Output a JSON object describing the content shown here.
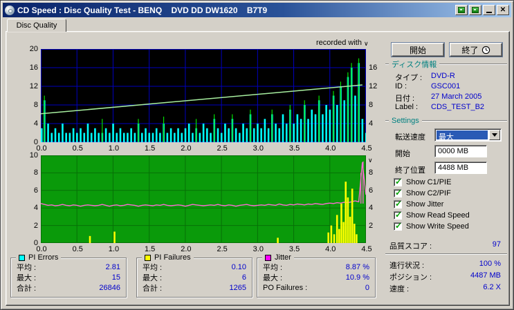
{
  "window": {
    "title": "CD Speed : Disc Quality Test - BENQ    DVD DD DW1620    B7T9"
  },
  "tab_label": "Disc Quality",
  "recorded_with": "recorded with",
  "icons": {
    "close": "✕",
    "check": "✓",
    "axis_arrow": "∨"
  },
  "colors": {
    "plot1_bg": "#000000",
    "plot1_grid": "#0000c0",
    "plot2_bg": "#0a9a0a",
    "plot2_grid": "#077007",
    "pi_errors": "#00ffff",
    "pie_spikes": "#00e000",
    "write_speed": "#a8f0a0",
    "jitter": "#ff6ad5",
    "pi_failures": "#ffff00",
    "value_text": "#0000cc",
    "group_title": "#008080"
  },
  "chart_data": [
    {
      "type": "bar",
      "title": "PI Errors vs disc position (GB)",
      "x_start": 0,
      "x_step": 0.05,
      "xlim": [
        0,
        4.5
      ],
      "ylim": [
        0,
        20
      ],
      "x_tick_labels": [
        "0.0",
        "0.5",
        "1.0",
        "1.5",
        "2.0",
        "2.5",
        "3.0",
        "3.5",
        "4.0",
        "4.5"
      ],
      "y_ticks_left": [
        20,
        16,
        12,
        8,
        4,
        0
      ],
      "y_ticks_right": [
        16,
        12,
        8,
        4
      ],
      "grid": true,
      "series": [
        {
          "name": "PI Errors",
          "color": "#00ffff",
          "values": [
            3,
            9,
            4,
            2,
            3,
            2,
            4,
            2,
            2,
            3,
            2,
            3,
            2,
            4,
            2,
            3,
            2,
            2,
            3,
            2,
            4,
            2,
            3,
            2,
            2,
            3,
            2,
            4,
            2,
            3,
            2,
            2,
            3,
            2,
            4,
            2,
            3,
            2,
            3,
            2,
            3,
            4,
            2,
            3,
            2,
            4,
            3,
            2,
            5,
            3,
            2,
            4,
            3,
            5,
            3,
            2,
            4,
            3,
            6,
            3,
            4,
            3,
            5,
            3,
            6,
            4,
            3,
            6,
            4,
            7,
            4,
            6,
            5,
            8,
            5,
            7,
            6,
            9,
            6,
            8,
            7,
            10,
            8,
            12,
            9,
            14,
            16,
            10,
            17,
            5,
            2
          ]
        },
        {
          "name": "PIE spikes",
          "color": "#00e000",
          "points": [
            [
              0.05,
              10
            ],
            [
              0.85,
              5
            ],
            [
              1.35,
              5
            ],
            [
              1.7,
              5.5
            ],
            [
              2.15,
              5
            ],
            [
              2.4,
              6
            ],
            [
              2.65,
              6
            ],
            [
              2.9,
              7
            ],
            [
              3.2,
              7
            ],
            [
              3.45,
              8
            ],
            [
              3.65,
              9
            ],
            [
              3.85,
              10
            ],
            [
              4.05,
              11
            ],
            [
              4.15,
              13
            ],
            [
              4.25,
              15
            ],
            [
              4.3,
              17
            ],
            [
              4.4,
              18
            ]
          ]
        },
        {
          "name": "Write Speed",
          "color": "#a8f0a0",
          "points": [
            [
              0,
              6.1
            ],
            [
              4.45,
              12.3
            ]
          ]
        }
      ]
    },
    {
      "type": "line",
      "title": "Jitter and PI Failures vs disc position (GB)",
      "x_start": 0,
      "x_step": 0.05,
      "xlim": [
        0,
        4.5
      ],
      "ylim": [
        0,
        10
      ],
      "x_tick_labels": [
        "0.0",
        "0.5",
        "1.0",
        "1.5",
        "2.0",
        "2.5",
        "3.0",
        "3.5",
        "4.0",
        "4.5"
      ],
      "y_ticks_left": [
        10,
        8,
        6,
        4,
        2,
        0
      ],
      "y_ticks_right": [
        8,
        6,
        4,
        2
      ],
      "grid": true,
      "series": [
        {
          "name": "Jitter",
          "color": "#ff6ad5",
          "values": [
            4.5,
            4.4,
            4.3,
            4.35,
            4.25,
            4.3,
            4.4,
            4.3,
            4.25,
            4.35,
            4.3,
            4.2,
            4.3,
            4.35,
            4.3,
            4.25,
            4.3,
            4.4,
            4.3,
            4.2,
            4.3,
            4.35,
            4.25,
            4.3,
            4.4,
            4.35,
            4.3,
            4.2,
            4.3,
            4.35,
            4.3,
            4.25,
            4.35,
            4.3,
            4.4,
            4.3,
            4.25,
            4.3,
            4.35,
            4.3,
            4.2,
            4.3,
            4.4,
            4.35,
            4.3,
            4.25,
            4.3,
            4.35,
            4.3,
            4.4,
            4.3,
            4.25,
            4.35,
            4.3,
            4.2,
            4.3,
            4.35,
            4.4,
            4.3,
            4.25,
            4.3,
            4.35,
            4.3,
            4.4,
            4.35,
            4.3,
            4.45,
            4.35,
            4.3,
            4.4,
            4.35,
            4.45,
            4.4,
            4.35,
            4.45,
            4.4,
            4.5,
            4.45,
            4.4,
            4.5,
            4.55,
            4.5,
            4.6,
            4.55,
            4.65,
            4.6,
            4.7,
            4.8,
            4.7,
            9.2,
            5.5
          ]
        },
        {
          "name": "Jitter spikes",
          "color": "#ff6ad5",
          "points": [
            [
              4.43,
              8.0
            ],
            [
              4.46,
              9.3
            ]
          ]
        },
        {
          "name": "PI Failures",
          "color": "#ffff00",
          "points": [
            [
              0.68,
              0.8
            ],
            [
              1.02,
              1.3
            ],
            [
              3.28,
              0.6
            ],
            [
              3.98,
              1.2
            ],
            [
              4.02,
              2.0
            ],
            [
              4.06,
              1.0
            ],
            [
              4.1,
              3.2
            ],
            [
              4.13,
              1.6
            ],
            [
              4.16,
              4.5
            ],
            [
              4.19,
              2.4
            ],
            [
              4.22,
              7.0
            ],
            [
              4.25,
              5.2
            ],
            [
              4.28,
              3.0
            ],
            [
              4.31,
              6.2
            ],
            [
              4.34,
              2.2
            ],
            [
              4.37,
              1.0
            ]
          ]
        }
      ]
    }
  ],
  "legend": [
    {
      "name": "PI Errors",
      "color": "#00ffff",
      "rows": [
        {
          "label": "平均 :",
          "value": "2.81"
        },
        {
          "label": "最大 :",
          "value": "15"
        },
        {
          "label": "合計 :",
          "value": "26846"
        }
      ]
    },
    {
      "name": "PI Failures",
      "color": "#ffff00",
      "rows": [
        {
          "label": "平均 :",
          "value": "0.10"
        },
        {
          "label": "最大 :",
          "value": "6"
        },
        {
          "label": "合計 :",
          "value": "1265"
        }
      ]
    },
    {
      "name": "Jitter",
      "color": "#ff00ff",
      "rows": [
        {
          "label": "平均 :",
          "value": "8.87 %"
        },
        {
          "label": "最大 :",
          "value": "10.9 %"
        },
        {
          "label": "PO Failures :",
          "value": "0"
        }
      ]
    }
  ],
  "panel": {
    "start_button": "開始",
    "exit_button": "終了",
    "disc_info": {
      "title": "ディスク情報",
      "rows": [
        {
          "label": "タイプ :",
          "value": "DVD-R"
        },
        {
          "label": "ID :",
          "value": "GSC001"
        },
        {
          "label": "日付 :",
          "value": "27 March 2005"
        },
        {
          "label": "Label :",
          "value": "CDS_TEST_B2"
        }
      ]
    },
    "settings": {
      "title": "Settings",
      "speed_label": "転送速度",
      "speed_value": "最大",
      "start_label": "開始",
      "start_value": "0000 MB",
      "end_label": "終了位置",
      "end_value": "4488 MB",
      "checkboxes": [
        "Show C1/PIE",
        "Show C2/PIF",
        "Show Jitter",
        "Show Read Speed",
        "Show Write Speed"
      ]
    },
    "quality_score_label": "品質スコア :",
    "quality_score_value": "97",
    "progress_label": "進行状況 :",
    "progress_value": "100 %",
    "position_label": "ポジション :",
    "position_value": "4487 MB",
    "rate_label": "速度 :",
    "rate_value": "6.2 X"
  }
}
